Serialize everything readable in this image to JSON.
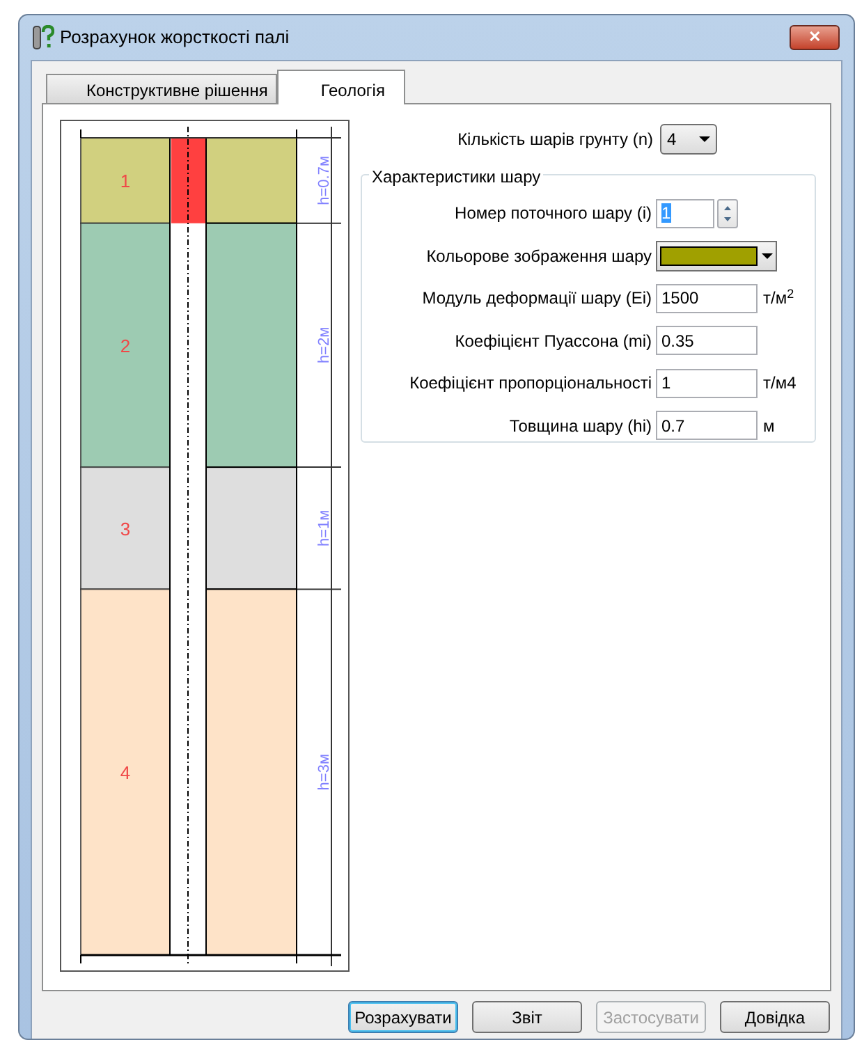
{
  "window": {
    "title": "Розрахунок жорсткості палі",
    "close": "✕"
  },
  "tabs": [
    {
      "label": "Конструктивне рішення",
      "selected": false
    },
    {
      "label": "Геологія",
      "selected": true
    }
  ],
  "layers": [
    {
      "number": "1",
      "height_label": "h=0.7м",
      "color": "#d1d07f",
      "selected": true
    },
    {
      "number": "2",
      "height_label": "h=2м",
      "color": "#9dcbb2",
      "selected": false
    },
    {
      "number": "3",
      "height_label": "h=1м",
      "color": "#dedede",
      "selected": false
    },
    {
      "number": "4",
      "height_label": "h=3м",
      "color": "#fee3c8",
      "selected": false
    }
  ],
  "layer_count": {
    "label": "Кількість шарів грунту (n)",
    "value": "4"
  },
  "layer_group": {
    "title": "Характеристики шару",
    "fields": [
      {
        "kind": "spinner",
        "label": "Номер поточного шару (i)",
        "value": "1"
      },
      {
        "kind": "color",
        "label": "Кольорове зображення шару",
        "color": "#a0a000"
      },
      {
        "kind": "text",
        "label": "Модуль деформації шару (Ei)",
        "value": "1500",
        "unit": "т/м$^{2}$"
      },
      {
        "kind": "text",
        "label": "Коефіцієнт Пуассона (mi)",
        "value": "0.35"
      },
      {
        "kind": "text",
        "label": "Коефіцієнт пропорціональності",
        "value": "1",
        "unit": "т/м4"
      },
      {
        "kind": "text",
        "label": "Товщина шару (hi)",
        "value": "0.7",
        "unit": "м"
      }
    ]
  },
  "buttons": [
    {
      "label": "Розрахувати",
      "default": true,
      "disabled": false
    },
    {
      "label": "Звіт",
      "default": false,
      "disabled": false
    },
    {
      "label": "Застосувати",
      "default": false,
      "disabled": true
    },
    {
      "label": "Довідка",
      "default": false,
      "disabled": false
    }
  ]
}
